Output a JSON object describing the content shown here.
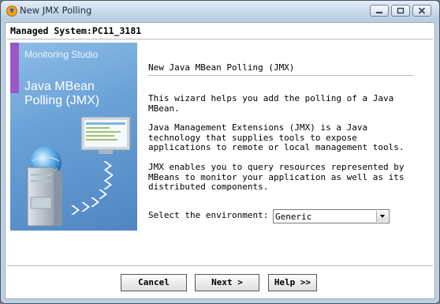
{
  "window": {
    "title": "New JMX Polling"
  },
  "header": {
    "managed_system": "Managed System:PC11_3181"
  },
  "side_panel": {
    "product": "Monitoring Studio",
    "title": "Java MBean Polling (JMX)"
  },
  "main": {
    "section_title": "New Java MBean Polling (JMX)",
    "paragraphs": [
      "This wizard helps you add the polling of a Java MBean.",
      "Java Management Extensions (JMX) is a Java technology that supplies tools to expose applications to remote or local management tools.",
      "JMX enables you to query resources represented by MBeans to monitor your application as well as its distributed components."
    ],
    "environment_label": "Select the environment:",
    "environment_value": "Generic"
  },
  "buttons": {
    "cancel": "Cancel",
    "next": "Next >",
    "help": "Help >>"
  },
  "icons": [
    "app-icon",
    "minimize-icon",
    "maximize-icon",
    "close-icon",
    "server-illustration",
    "globe-illustration",
    "monitor-illustration",
    "chevron-down-icon"
  ]
}
